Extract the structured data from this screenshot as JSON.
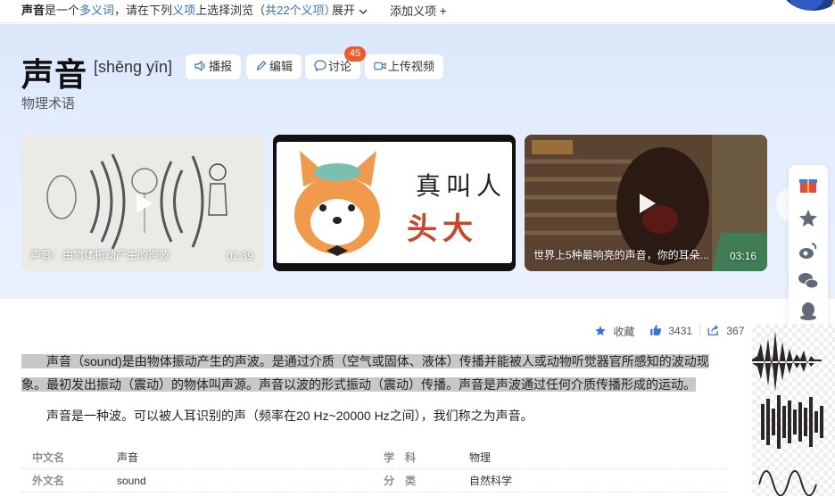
{
  "topbar": {
    "term": "声音",
    "notice_mid": "是一个",
    "polysemy_link": "多义词",
    "notice_tail": "，请在下列",
    "item_link": "义项",
    "notice_tail2": "上选择浏览（",
    "count_link": "共22个义项",
    "notice_end": "）",
    "expand_label": "展开",
    "add_label": "添加义项"
  },
  "header": {
    "title": "声音",
    "pinyin": "[shēng yīn]",
    "subtitle": "物理术语",
    "buttons": {
      "play": "播报",
      "edit": "编辑",
      "discuss": "讨论",
      "upload": "上传视频"
    },
    "discuss_badge": "45"
  },
  "videos": [
    {
      "caption": "声音：由物体振动产生的声波",
      "duration": "02:39"
    },
    {
      "caption": "",
      "duration": "",
      "art_line1": "真叫人",
      "art_line2": "头大"
    },
    {
      "caption": "世界上5种最响亮的声音，你的耳朵...",
      "duration": "03:16"
    }
  ],
  "content_actions": {
    "collect": "收藏",
    "likes": "3431",
    "shares": "367"
  },
  "paragraphs": {
    "p1": "声音（sound)是由物体振动产生的声波。是通过介质（空气或固体、液体）传播并能被人或动物听觉器官所感知的波动现象。最初发出振动（震动）的物体叫声源。声音以波的形式振动（震动）传播。声音是声波通过任何介质传播形成的运动。",
    "p2": "声音是一种波。可以被人耳识别的声（频率在20 Hz~20000 Hz之间），我们称之为声音。"
  },
  "basic_info": [
    {
      "k1": "中文名",
      "v1": "声音",
      "k2": "学　科",
      "v2": "物理"
    },
    {
      "k1": "外文名",
      "v1": "sound",
      "k2": "分　类",
      "v2": "自然科学"
    }
  ],
  "colors": {
    "accent": "#2e6fc4",
    "badge": "#f05a2a",
    "hero_bg": "#dfeafb"
  }
}
